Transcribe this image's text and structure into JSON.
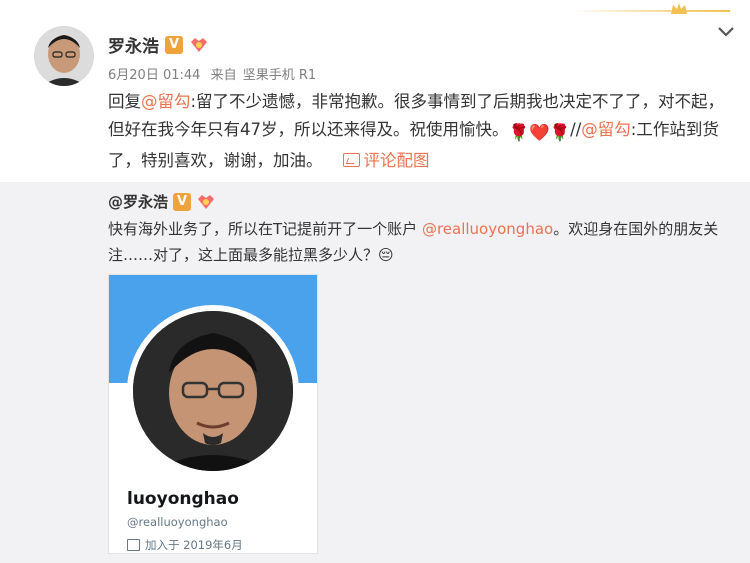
{
  "post": {
    "author": "罗永浩",
    "verified_badge": "V",
    "date": "6月20日 01:44",
    "source_prefix": "来自",
    "source": "坚果手机 R1",
    "reply_prefix": "回复",
    "mention1": "@留勾",
    "text1": ":留了不少遗憾，非常抱歉。很多事情到了后期我也决定不了了，对不起，但好在我今年只有47岁，所以还来得及。祝使用愉快。",
    "separator": "//",
    "mention2": "@留勾",
    "text2": ":工作站到货了，特别喜欢，谢谢，加油。",
    "image_comment": "评论配图",
    "emojis": "🌹❤️🌹"
  },
  "repost": {
    "author": "@罗永浩",
    "verified_badge": "V",
    "text_part1": "快有海外业务了，所以在T记提前开了一个账户",
    "mention": "@realluoyonghao",
    "text_part2": "。欢迎身在国外的朋友关注……对了，这上面最多能拉黑多少人？",
    "emoji": "😔"
  },
  "card": {
    "display_name": "luoyonghao",
    "handle": "@realluoyonghao",
    "joined": "加入于 2019年6月"
  },
  "icons": {
    "crown": "crown-icon",
    "chevron": "chevron-down-icon",
    "vip": "vip-icon",
    "image": "image-icon",
    "calendar": "calendar-icon"
  },
  "colors": {
    "link": "#eb7350",
    "badge": "#f0a33b",
    "banner": "#4aa1ec",
    "repost_bg": "#f2f2f5"
  }
}
